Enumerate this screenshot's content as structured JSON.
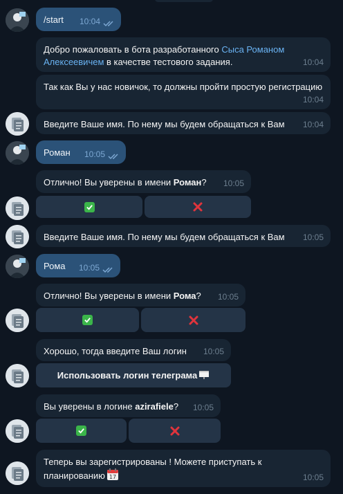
{
  "messages": [
    {
      "text": "/start",
      "time": "10:04"
    },
    {
      "parts": [
        "Добро пожаловать в бота разработанного ",
        "Сыса Романом Алексеевичем",
        " в качестве тестового задания."
      ],
      "time": "10:04"
    },
    {
      "text": "Так как Вы у нас новичок, то должны пройти простую регистрацию",
      "time": "10:04"
    },
    {
      "text": "Введите Ваше имя. По нему мы будем обращаться к Вам",
      "time": "10:04"
    },
    {
      "text": "Роман",
      "time": "10:05"
    },
    {
      "parts": [
        "Отлично! Вы уверены в имени ",
        "Роман",
        "?"
      ],
      "time": "10:05"
    },
    {
      "text": "Введите Ваше имя. По нему мы будем обращаться к Вам",
      "time": "10:05"
    },
    {
      "text": "Рома",
      "time": "10:05"
    },
    {
      "parts": [
        "Отлично! Вы уверены в имени ",
        "Рома",
        "?"
      ],
      "time": "10:05"
    },
    {
      "text": "Хорошо, тогда введите Ваш логин",
      "time": "10:05"
    },
    {
      "parts": [
        "Вы уверены в логине ",
        "azirafiele",
        "?"
      ],
      "time": "10:05"
    },
    {
      "text": "Теперь вы зарегистрированы ! Можете приступать к планированию",
      "time": "10:05"
    }
  ],
  "keyboard": {
    "use_telegram_login": "Использовать логин телеграма",
    "confirm_icon": "check-mark-emoji",
    "reject_icon": "cross-mark-emoji"
  },
  "colors": {
    "background": "#0e1621",
    "incoming_bubble": "#182533",
    "outgoing_bubble": "#2b5278",
    "keyboard_button": "#243447",
    "link": "#6ab3f3"
  }
}
